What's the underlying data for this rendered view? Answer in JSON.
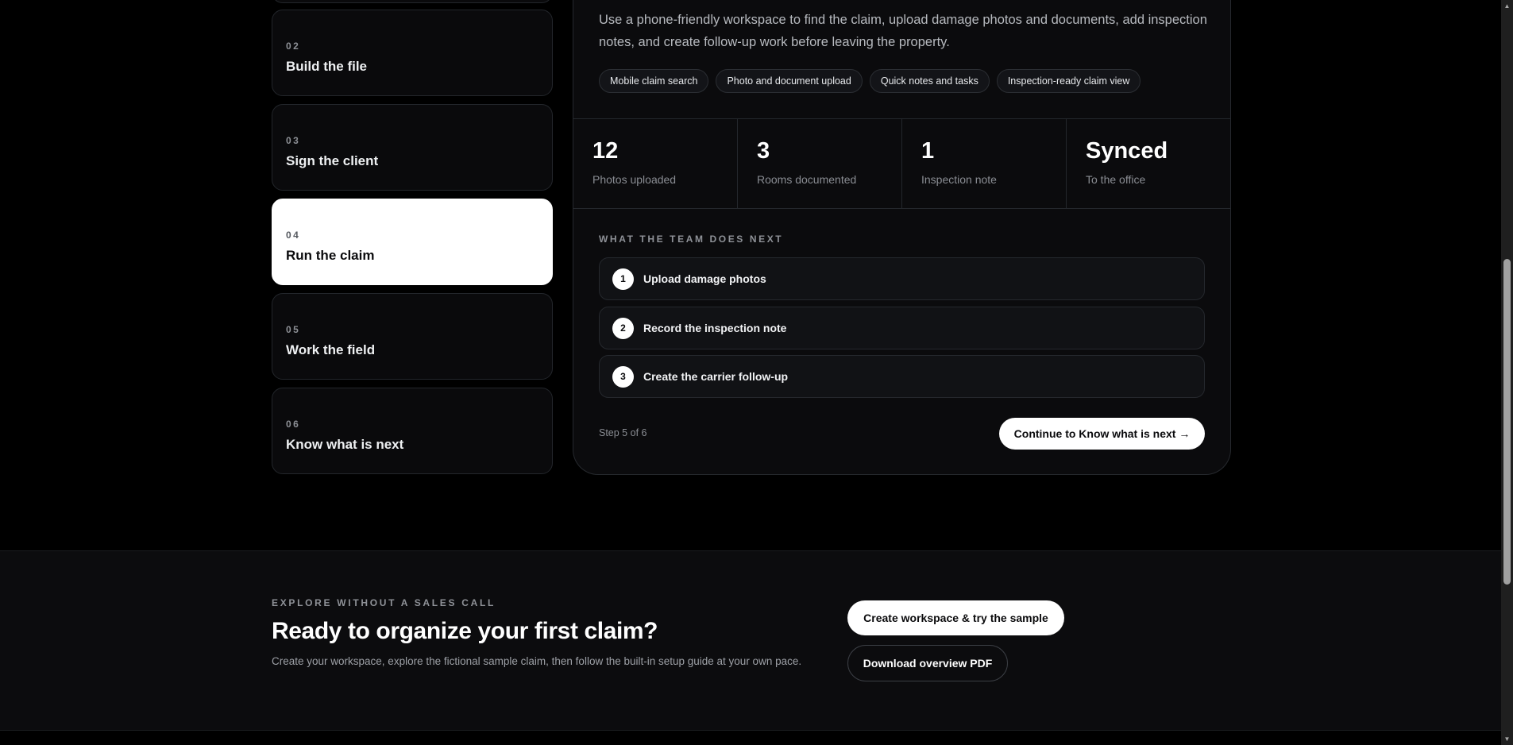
{
  "steps": [
    {
      "num": "02",
      "title": "Build the file"
    },
    {
      "num": "03",
      "title": "Sign the client"
    },
    {
      "num": "04",
      "title": "Run the claim"
    },
    {
      "num": "05",
      "title": "Work the field"
    },
    {
      "num": "06",
      "title": "Know what is next"
    }
  ],
  "panel": {
    "description": "Use a phone-friendly workspace to find the claim, upload damage photos and documents, add inspection notes, and create follow-up work before leaving the property.",
    "tags": [
      "Mobile claim search",
      "Photo and document upload",
      "Quick notes and tasks",
      "Inspection-ready claim view"
    ],
    "stats": [
      {
        "value": "12",
        "label": "Photos uploaded"
      },
      {
        "value": "3",
        "label": "Rooms documented"
      },
      {
        "value": "1",
        "label": "Inspection note"
      },
      {
        "value": "Synced",
        "label": "To the office"
      }
    ],
    "section_label": "WHAT THE TEAM DOES NEXT",
    "tasks": [
      {
        "num": "1",
        "label": "Upload damage photos"
      },
      {
        "num": "2",
        "label": "Record the inspection note"
      },
      {
        "num": "3",
        "label": "Create the carrier follow-up"
      }
    ],
    "step_counter": "Step 5 of 6",
    "continue_label": "Continue to Know what is next →"
  },
  "cta": {
    "eyebrow": "EXPLORE WITHOUT A SALES CALL",
    "headline": "Ready to organize your first claim?",
    "subtext": "Create your workspace, explore the fictional sample claim, then follow the built-in setup guide at your own pace.",
    "primary_button": "Create workspace & try the sample",
    "secondary_button": "Download overview PDF"
  },
  "scrollbar": {
    "up_icon": "▲",
    "down_icon": "▼"
  }
}
